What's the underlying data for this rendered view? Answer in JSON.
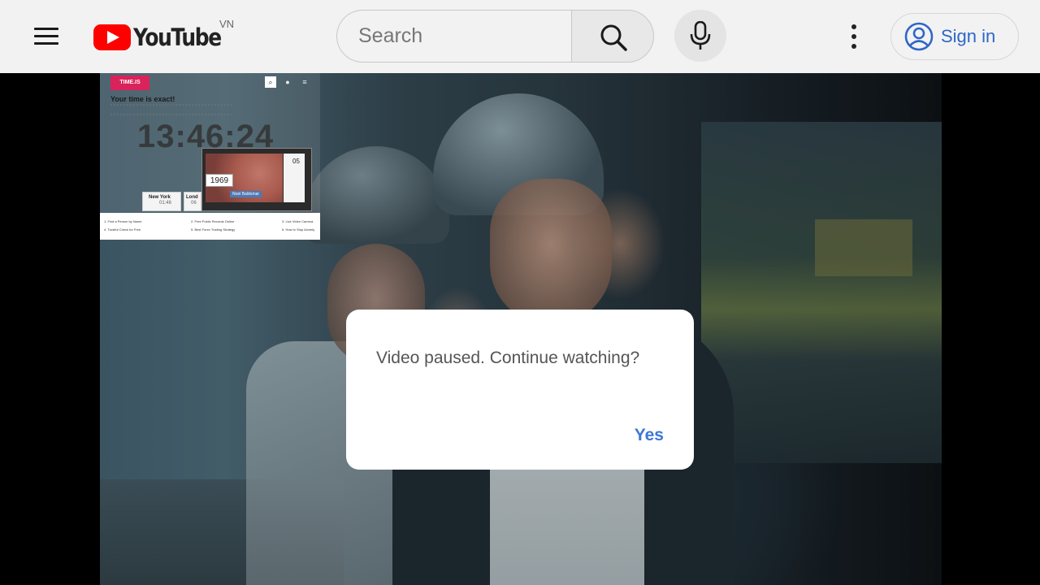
{
  "header": {
    "logo_text": "YouTube",
    "region": "VN",
    "search_placeholder": "Search",
    "signin_label": "Sign in",
    "icons": [
      "menu-icon",
      "youtube-logo",
      "search-icon",
      "mic-icon",
      "more-vert-icon",
      "account-icon"
    ]
  },
  "pip": {
    "badge": "TIME.IS",
    "title": "Your time is exact!",
    "clock": "13:46:24",
    "year": "1969",
    "day": "05",
    "caption": "Noel Baldomar",
    "cities": [
      {
        "name": "New York",
        "time": "01:46"
      },
      {
        "name": "Lond",
        "time": "06"
      }
    ],
    "links": [
      "1. Find a Person by Name",
      "2. Free Public Records Online",
      "3. Live Video Camera",
      "4. Trustful Check for Free",
      "5. Best Forex Trading Strategy",
      "6. How to Stop Anxiety"
    ]
  },
  "dialog": {
    "message": "Video paused. Continue watching?",
    "yes_label": "Yes"
  },
  "colors": {
    "brand_red": "#ff0000",
    "link_blue": "#3d77d4",
    "header_bg": "#f2f2f2"
  }
}
